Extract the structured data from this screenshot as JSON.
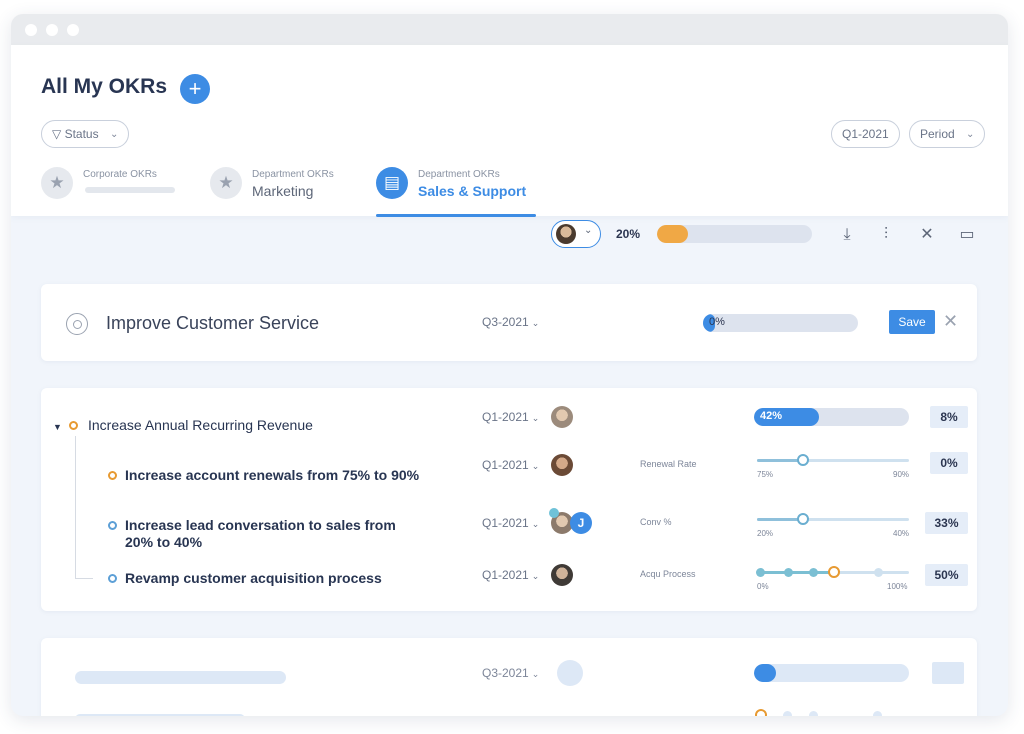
{
  "header": {
    "page_title": "All My OKRs",
    "add_symbol": "+",
    "status_filter": "Status",
    "quarter": "Q1-2021",
    "period": "Period"
  },
  "tabs": [
    {
      "small": "Corporate OKRs",
      "big": "",
      "active": false,
      "icon": "star-icon"
    },
    {
      "small": "Department OKRs",
      "big": "Marketing",
      "active": false,
      "icon": "star-icon"
    },
    {
      "small": "Department OKRs",
      "big": "Sales & Support",
      "active": true,
      "icon": "document-icon"
    }
  ],
  "toolbar": {
    "overall_progress_label": "20%",
    "overall_progress": 0.2,
    "icons": [
      "download-icon",
      "chart-icon",
      "collapse-icon",
      "comment-icon"
    ]
  },
  "objective_edit": {
    "title": "Improve Customer Service",
    "period": "Q3-2021",
    "progress_label": "0%",
    "progress": 0.0,
    "save_label": "Save",
    "close_symbol": "✕"
  },
  "objective": {
    "title": "Increase Annual Recurring Revenue",
    "period": "Q1-2021",
    "progress_label": "42%",
    "progress": 0.42,
    "badge": "8%",
    "key_results": [
      {
        "title_line1": "Increase account renewals from 75% to 90%",
        "title_line2": "",
        "period": "Q1-2021",
        "metric": "Renewal Rate",
        "min_label": "75%",
        "max_label": "90%",
        "badge": "0%",
        "progress": 0.3
      },
      {
        "title_line1": "Increase lead conversation to sales from",
        "title_line2": "20% to 40%",
        "period": "Q1-2021",
        "metric": "Conv %",
        "min_label": "20%",
        "max_label": "40%",
        "badge": "33%",
        "progress": 0.3,
        "avatar_initial": "J"
      },
      {
        "title_line1": "Revamp customer acquisition process",
        "title_line2": "",
        "period": "Q1-2021",
        "metric": "Acqu Process",
        "min_label": "0%",
        "max_label": "100%",
        "badge": "50%",
        "progress": 0.5
      }
    ]
  },
  "placeholder_card": {
    "period": "Q3-2021"
  },
  "colors": {
    "accent": "#3d8ce4",
    "progress_orange": "#f0a845",
    "bullet_orange": "#e79a32",
    "bullet_blue": "#5c9fd6",
    "teal": "#7bbfd3"
  }
}
